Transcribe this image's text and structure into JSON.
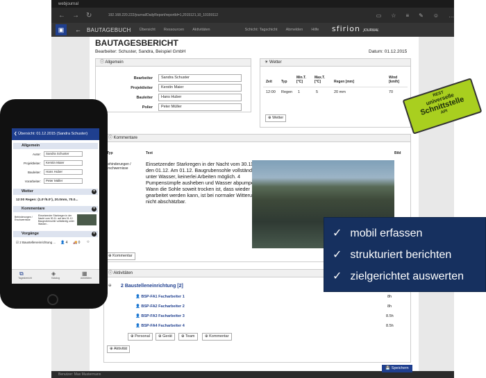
{
  "browser": {
    "tab_title": "webjournal",
    "url": "192.168.220.222/journal/DailyReport/reportId=1,2015121,10_10159112"
  },
  "app": {
    "title": "BAUTAGEBUCH",
    "nav": [
      "Übersicht",
      "Ressourcen",
      "Aktivitäten",
      "Schicht: Tagschicht",
      "Abmelden",
      "Hilfe"
    ],
    "brand": "sfirion",
    "brand_sub": "JOURNAL"
  },
  "report": {
    "title": "BAUTAGESBERICHT",
    "bearbeiter": "Bearbeiter: Schuster, Sandra, Beispiel GmbH",
    "datum": "Datum: 01.12.2015"
  },
  "allgemein": {
    "header": "Allgemein",
    "rows": [
      {
        "label": "Bearbeiter",
        "value": "Sandra Schuster"
      },
      {
        "label": "Projektleiter",
        "value": "Kerstin Maier"
      },
      {
        "label": "Bauleiter",
        "value": "Hans Huber"
      },
      {
        "label": "Polier",
        "value": "Peter Müller"
      }
    ]
  },
  "wetter": {
    "header": "Wetter",
    "cols": [
      "Zeit",
      "Typ",
      "Min.T. [°C]",
      "Max.T. [°C]",
      "Regen [mm]",
      "Wind [km/h]"
    ],
    "row": [
      "12:00",
      "Regen",
      "1",
      "5",
      "20 mm",
      "70"
    ],
    "button": "Wetter"
  },
  "kommentare": {
    "header": "Kommentare",
    "cols": [
      "Typ",
      "Text",
      "Bild"
    ],
    "typ": "Behinderungen / Erschwernisse",
    "text": "Einsetzender Starkregen in der Nacht vom 30.11. auf den 01.12. Am 01.12. Baugrubensohle vollständig unter Wasser, keinerlei Arbeiten möglich. 4 Pumpensümpfe ausheben und Wasser abpumpen. Wann die Sohle soweit trocken ist, dass wieder gearbeitet werden kann, ist bei normaler Witterung nicht abschätzbar.",
    "button": "Kommentar"
  },
  "aktivitaeten": {
    "header": "Aktivitäten",
    "group": "2 Baustelleneinrichtung [2]",
    "rows": [
      {
        "name": "BSP-FA1 Facharbeiter 1",
        "hours": "8h"
      },
      {
        "name": "BSP-FA2 Facharbeiter 2",
        "hours": "8h"
      },
      {
        "name": "BSP-FA3 Facharbeiter 3",
        "hours": "8.5h"
      },
      {
        "name": "BSP-FA4 Facharbeiter 4",
        "hours": "8.5h"
      }
    ],
    "buttons": [
      "Personal",
      "Gerät",
      "Team",
      "Kommentar"
    ],
    "add_button": "Aktivität"
  },
  "save": "Speichern",
  "statusbar": "Benutzer: Max Mustermann",
  "badge": {
    "l1": "REST",
    "l2": "universelle",
    "l3": "Schnittstelle",
    "l4": "API"
  },
  "overlay": [
    "mobil erfassen",
    "strukturiert berichten",
    "zielgerichtet auswerten"
  ],
  "phone": {
    "header": "Übersicht: 01.12.2015 (Sandra Schuster)",
    "allgemein": "Allgemein",
    "fields": [
      {
        "label": "Autor:",
        "value": "Sandra Schuster"
      },
      {
        "label": "Projektleiter:",
        "value": "Kerstin Maier"
      },
      {
        "label": "Bauleiter:",
        "value": "Hans Huber"
      },
      {
        "label": "Vorarbeiter:",
        "value": "Peter Müller"
      }
    ],
    "wetter": "Wetter",
    "wetter_line": "12:00 Regen: (1.0°/5.0°), 20.0mm, 70.0...",
    "kommentare": "Kommentare",
    "k_typ": "Behinderungen / Erschwernisse",
    "k_text": "Einsetzender Starkregen in der Nacht vom 30.11. auf den 01.12. Baugrubensohle vollständig unter Wasser...",
    "vorgaenge": "Vorgänge",
    "vorgang": "2 Baustelleneinrichtung ...",
    "v_count1": "4",
    "v_count2": "0",
    "tabs": [
      "Tagesbericht",
      "Katalog",
      "Aktivitäten"
    ]
  }
}
